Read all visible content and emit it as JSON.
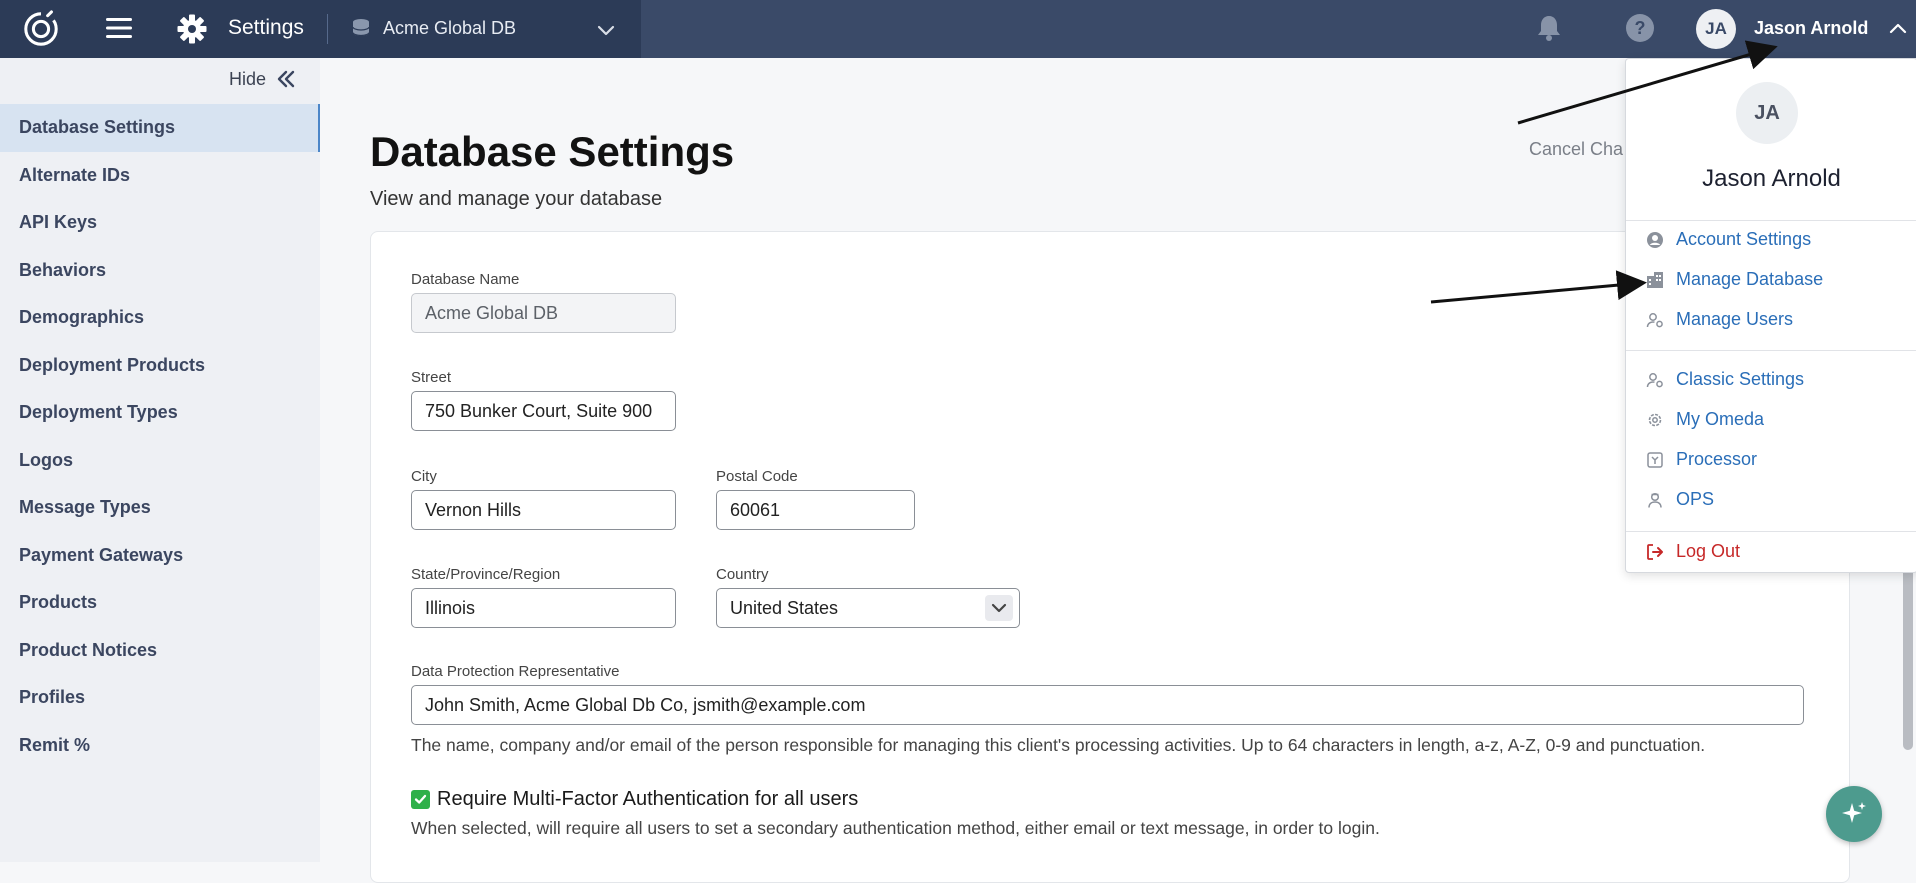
{
  "topbar": {
    "section_title": "Settings",
    "database_name": "Acme Global DB",
    "user_initials": "JA",
    "user_name": "Jason Arnold"
  },
  "sidebar": {
    "hide_label": "Hide",
    "items": [
      {
        "label": "Database Settings",
        "active": true
      },
      {
        "label": "Alternate IDs"
      },
      {
        "label": "API Keys"
      },
      {
        "label": "Behaviors"
      },
      {
        "label": "Demographics"
      },
      {
        "label": "Deployment Products"
      },
      {
        "label": "Deployment Types"
      },
      {
        "label": "Logos"
      },
      {
        "label": "Message Types"
      },
      {
        "label": "Payment Gateways"
      },
      {
        "label": "Products"
      },
      {
        "label": "Product Notices"
      },
      {
        "label": "Profiles"
      },
      {
        "label": "Remit %"
      }
    ]
  },
  "main": {
    "title": "Database Settings",
    "subtitle": "View and manage your database",
    "cancel_label": "Cancel Cha",
    "form": {
      "database_name": {
        "label": "Database Name",
        "value": "Acme Global DB"
      },
      "street": {
        "label": "Street",
        "value": "750 Bunker Court, Suite 900"
      },
      "city": {
        "label": "City",
        "value": "Vernon Hills"
      },
      "postal_code": {
        "label": "Postal Code",
        "value": "60061"
      },
      "state": {
        "label": "State/Province/Region",
        "value": "Illinois"
      },
      "country": {
        "label": "Country",
        "value": "United States"
      },
      "dpr": {
        "label": "Data Protection Representative",
        "value": "John Smith, Acme Global Db Co, jsmith@example.com",
        "help": "The name, company and/or email of the person responsible for managing this client's processing activities. Up to 64 characters in length, a-z, A-Z, 0-9 and punctuation."
      },
      "mfa": {
        "label": "Require Multi-Factor Authentication for all users",
        "help": "When selected, will require all users to set a secondary authentication method, either email or text message, in order to login."
      }
    }
  },
  "user_menu": {
    "initials": "JA",
    "name": "Jason Arnold",
    "items": [
      {
        "label": "Account Settings",
        "icon": "user-circle-icon"
      },
      {
        "label": "Manage Database",
        "icon": "building-icon"
      },
      {
        "label": "Manage Users",
        "icon": "user-gear-icon"
      },
      {
        "label": "Classic Settings",
        "icon": "user-gear-icon"
      },
      {
        "label": "My Omeda",
        "icon": "gear-icon"
      },
      {
        "label": "Processor",
        "icon": "processor-icon"
      },
      {
        "label": "OPS",
        "icon": "person-icon"
      },
      {
        "label": "Log Out",
        "icon": "logout-icon"
      }
    ]
  },
  "colors": {
    "topbar": "#3a4a68",
    "topbar_left": "#2c3b57",
    "sidebar_bg": "#eef0f4",
    "sidebar_active": "#d7e3f1",
    "link": "#2a6eb8",
    "logout": "#c62828",
    "checkbox": "#2fb04a",
    "ai_button": "#4d9b8e"
  }
}
